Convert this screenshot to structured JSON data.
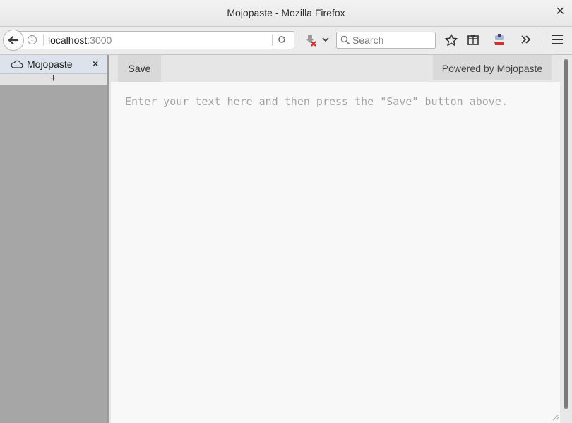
{
  "window": {
    "title": "Mojopaste - Mozilla Firefox"
  },
  "navbar": {
    "url_host": "localhost",
    "url_port": ":3000",
    "search_placeholder": "Search"
  },
  "sidebar": {
    "tab_label": "Mojopaste",
    "close_glyph": "×",
    "add_glyph": "+"
  },
  "page": {
    "save_label": "Save",
    "powered_by": "Powered by Mojopaste",
    "editor_placeholder": "Enter your text here and then press the \"Save\" button above."
  },
  "icons": {
    "back": "back-arrow-icon",
    "info": "info-icon",
    "reload": "reload-icon",
    "download": "download-blocked-icon",
    "search": "magnifier-icon",
    "bookmark": "star-icon",
    "reading": "clipboard-icon",
    "extension": "extension-icon",
    "overflow": "chevron-double-icon",
    "menu": "hamburger-menu-icon"
  },
  "colors": {
    "sidebar_bg": "#a6a6a6",
    "tab_bg": "#dde3ec",
    "editor_bg": "#f8f8f8"
  }
}
